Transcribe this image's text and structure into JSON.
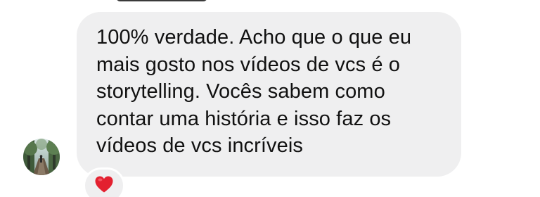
{
  "message": {
    "text": "100% verdade. Acho que o que eu\nmais gosto nos vídeos de vcs é o\nstorytelling. Vocês sabem como\ncontar uma história e isso faz os\nvídeos de vcs incríveis"
  },
  "reaction": {
    "icon": "red-heart-icon",
    "color": "#e3202f"
  },
  "avatar": {
    "icon": "profile-photo-forest-icon"
  },
  "colors": {
    "bubble": "#efeff0",
    "text": "#111111",
    "background": "#ffffff"
  }
}
